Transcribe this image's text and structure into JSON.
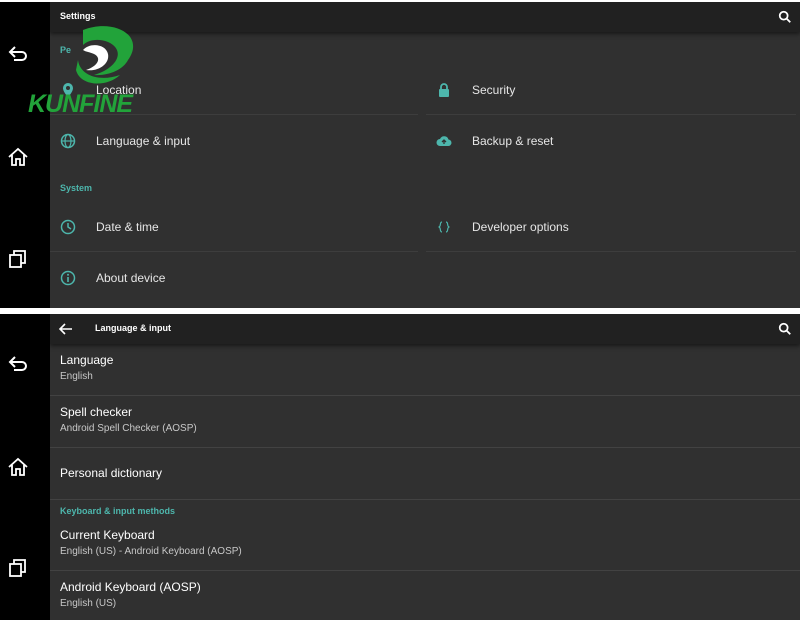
{
  "logo": {
    "text": "KUNFINE"
  },
  "settings": {
    "title": "Settings",
    "section_personal": "Pe",
    "section_system": "System",
    "tiles": {
      "location": "Location",
      "security": "Security",
      "language": "Language & input",
      "backup": "Backup & reset",
      "datetime": "Date & time",
      "developer": "Developer options",
      "about": "About device"
    }
  },
  "language_input": {
    "title": "Language & input",
    "items": [
      {
        "title": "Language",
        "summary": "English"
      },
      {
        "title": "Spell checker",
        "summary": "Android Spell Checker (AOSP)"
      },
      {
        "title": "Personal dictionary",
        "summary": ""
      },
      {
        "title": "Current Keyboard",
        "summary": "English (US) - Android Keyboard (AOSP)"
      },
      {
        "title": "Android Keyboard (AOSP)",
        "summary": "English (US)"
      }
    ],
    "section_keyboard": "Keyboard & input methods"
  },
  "colors": {
    "accent": "#4db6ac",
    "background": "#303030",
    "appbar": "#212121",
    "navbar": "#000000",
    "logo": "#22a33a"
  },
  "icons": [
    "back-icon",
    "home-icon",
    "recents-icon",
    "search-icon",
    "location-icon",
    "lock-icon",
    "globe-icon",
    "cloud-upload-icon",
    "clock-icon",
    "braces-icon",
    "info-icon",
    "arrow-back-icon"
  ]
}
